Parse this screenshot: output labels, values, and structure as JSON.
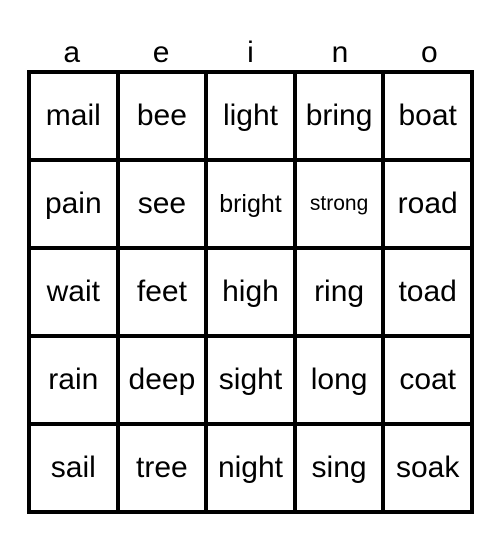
{
  "card": {
    "type": "word-bingo-card",
    "columns": 5,
    "rows": 5,
    "border_color": "#000000",
    "background_color": "#ffffff",
    "text_color": "#000000"
  },
  "header": {
    "letters": [
      "a",
      "e",
      "i",
      "n",
      "o"
    ]
  },
  "grid": {
    "rows": [
      {
        "cells": [
          {
            "word": "mail",
            "size": "normal"
          },
          {
            "word": "bee",
            "size": "normal"
          },
          {
            "word": "light",
            "size": "normal"
          },
          {
            "word": "bring",
            "size": "normal"
          },
          {
            "word": "boat",
            "size": "normal"
          }
        ]
      },
      {
        "cells": [
          {
            "word": "pain",
            "size": "normal"
          },
          {
            "word": "see",
            "size": "normal"
          },
          {
            "word": "bright",
            "size": "small"
          },
          {
            "word": "strong",
            "size": "smaller"
          },
          {
            "word": "road",
            "size": "normal"
          }
        ]
      },
      {
        "cells": [
          {
            "word": "wait",
            "size": "normal"
          },
          {
            "word": "feet",
            "size": "normal"
          },
          {
            "word": "high",
            "size": "normal"
          },
          {
            "word": "ring",
            "size": "normal"
          },
          {
            "word": "toad",
            "size": "normal"
          }
        ]
      },
      {
        "cells": [
          {
            "word": "rain",
            "size": "normal"
          },
          {
            "word": "deep",
            "size": "normal"
          },
          {
            "word": "sight",
            "size": "normal"
          },
          {
            "word": "long",
            "size": "normal"
          },
          {
            "word": "coat",
            "size": "normal"
          }
        ]
      },
      {
        "cells": [
          {
            "word": "sail",
            "size": "normal"
          },
          {
            "word": "tree",
            "size": "normal"
          },
          {
            "word": "night",
            "size": "normal"
          },
          {
            "word": "sing",
            "size": "normal"
          },
          {
            "word": "soak",
            "size": "normal"
          }
        ]
      }
    ]
  }
}
